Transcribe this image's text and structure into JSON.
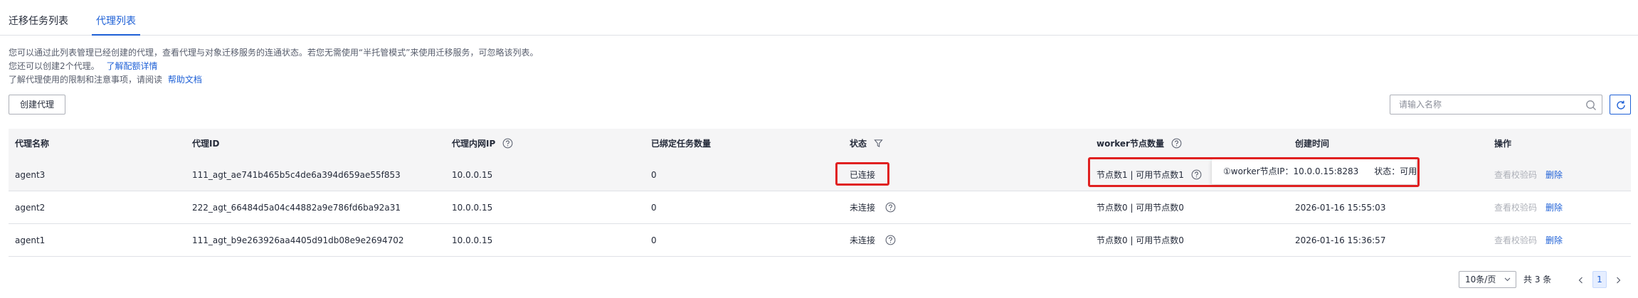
{
  "tabs": [
    {
      "label": "迁移任务列表",
      "active": false
    },
    {
      "label": "代理列表",
      "active": true
    }
  ],
  "intro": {
    "line1": "您可以通过此列表管理已经创建的代理，查看代理与对象迁移服务的连通状态。若您无需使用“半托管模式”来使用迁移服务，可忽略该列表。",
    "line2_text": "您还可以创建2个代理。",
    "line2_link": "了解配额详情",
    "line3_text": "了解代理使用的限制和注意事项，请阅读",
    "line3_link": "帮助文档"
  },
  "toolbar": {
    "create_label": "创建代理",
    "search_placeholder": "请输入名称"
  },
  "table": {
    "columns": [
      "代理名称",
      "代理ID",
      "代理内网IP",
      "已绑定任务数量",
      "状态",
      "worker节点数量",
      "创建时间",
      "操作"
    ],
    "rows": [
      {
        "name": "agent3",
        "id": "111_agt_ae741b465b5c4de6a394d659ae55f853",
        "ip": "10.0.0.15",
        "bound": "0",
        "status": "已连接",
        "worker": "节点数1 | 可用节点数1",
        "time": "",
        "verify": "查看校验码",
        "delete": "删除"
      },
      {
        "name": "agent2",
        "id": "222_agt_66484d5a04c44882a9e786fd6ba92a31",
        "ip": "10.0.0.15",
        "bound": "0",
        "status": "未连接",
        "worker": "节点数0 | 可用节点数0",
        "time": "2026-01-16 15:55:03",
        "verify": "查看校验码",
        "delete": "删除"
      },
      {
        "name": "agent1",
        "id": "111_agt_b9e263926aa4405d91db08e9e2694702",
        "ip": "10.0.0.15",
        "bound": "0",
        "status": "未连接",
        "worker": "节点数0 | 可用节点数0",
        "time": "2026-01-16 15:36:57",
        "verify": "查看校验码",
        "delete": "删除"
      }
    ]
  },
  "tooltip": {
    "worker": "①worker节点IP：10.0.0.15:8283",
    "state": "状态：可用"
  },
  "pagination": {
    "page_size": "10条/页",
    "total": "共 3 条",
    "current_page": "1"
  },
  "colors": {
    "accent": "#1e60d6",
    "highlight": "#e02020",
    "header_bg": "#f5f5f6"
  },
  "icons": [
    "search-icon",
    "refresh-icon",
    "help-icon",
    "filter-icon",
    "chevron-down-icon",
    "chevron-left-icon",
    "chevron-right-icon"
  ]
}
